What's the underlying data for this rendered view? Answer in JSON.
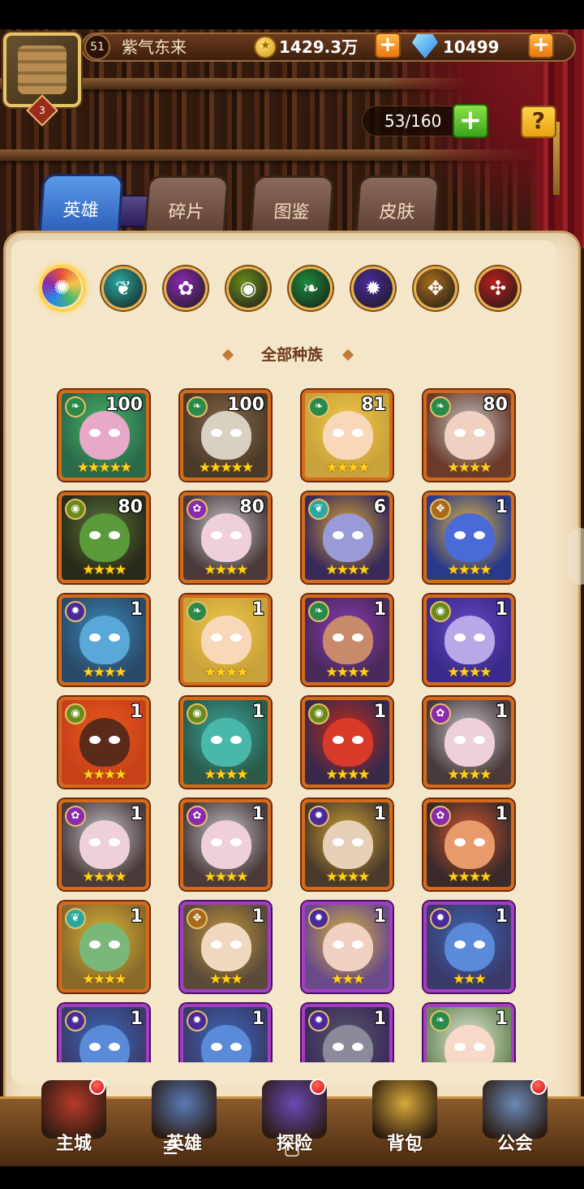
{
  "player": {
    "level": "51",
    "name": "紫气东来",
    "avatar_level": "3"
  },
  "resources": {
    "gold": "1429.3万",
    "gems": "10499"
  },
  "capacity": "53/160",
  "tabs": [
    {
      "label": "英雄",
      "active": true
    },
    {
      "label": "碎片",
      "active": false
    },
    {
      "label": "图鉴",
      "active": false
    },
    {
      "label": "皮肤",
      "active": false
    }
  ],
  "race_filters": [
    {
      "name": "all-races",
      "color": "#e8503a"
    },
    {
      "name": "fortress",
      "color": "#2aa8a0"
    },
    {
      "name": "abyss",
      "color": "#8a2ab0"
    },
    {
      "name": "forest",
      "color": "#6a8a1a"
    },
    {
      "name": "shadow",
      "color": "#1a8a3a"
    },
    {
      "name": "dark",
      "color": "#4a2a9a"
    },
    {
      "name": "light",
      "color": "#a86a1a"
    },
    {
      "name": "hell",
      "color": "#b8201a"
    }
  ],
  "race_title": "全部种族",
  "heroes": [
    {
      "level": "100",
      "stars": "★★★★★",
      "elem": "green",
      "tone": "#4ab86a",
      "skin": "#e8a8c8",
      "bg": "#2a6a4a",
      "frame": "orange"
    },
    {
      "level": "100",
      "stars": "★★★★★",
      "elem": "green",
      "tone": "#8a6a4a",
      "skin": "#d8d0c0",
      "bg": "#4a3a2a",
      "frame": "orange"
    },
    {
      "level": "81",
      "stars": "★★★★",
      "elem": "green",
      "tone": "#f2c84a",
      "skin": "#f8d8b8",
      "bg": "#c8a23a",
      "frame": "orange"
    },
    {
      "level": "80",
      "stars": "★★★★",
      "elem": "green",
      "tone": "#c8c8c8",
      "skin": "#f0d0c0",
      "bg": "#6a3a2a",
      "frame": "orange"
    },
    {
      "level": "80",
      "stars": "★★★★",
      "elem": "olive",
      "tone": "#5a7a3a",
      "skin": "#5a9a3a",
      "bg": "#2a2a1a",
      "frame": "orange"
    },
    {
      "level": "80",
      "stars": "★★★★",
      "elem": "purple",
      "tone": "#c8c8d0",
      "skin": "#f0d0d8",
      "bg": "#4a3a3a",
      "frame": "orange"
    },
    {
      "level": "6",
      "stars": "★★★★",
      "elem": "teal",
      "tone": "#d8a83a",
      "skin": "#9a9ad8",
      "bg": "#3a2a5a",
      "frame": "orange"
    },
    {
      "level": "1",
      "stars": "★★★★",
      "elem": "sun",
      "tone": "#e8b83a",
      "skin": "#4a6ad8",
      "bg": "#2a3a8a",
      "frame": "orange"
    },
    {
      "level": "1",
      "stars": "★★★★",
      "elem": "dark",
      "tone": "#3a8ab8",
      "skin": "#5aa8d8",
      "bg": "#2a4a6a",
      "frame": "orange"
    },
    {
      "level": "1",
      "stars": "★★★★",
      "elem": "green",
      "tone": "#f2c84a",
      "skin": "#f8d8b8",
      "bg": "#c8a23a",
      "frame": "orange"
    },
    {
      "level": "1",
      "stars": "★★★★",
      "elem": "green",
      "tone": "#8a3ab8",
      "skin": "#c88a6a",
      "bg": "#4a2a5a",
      "frame": "orange"
    },
    {
      "level": "1",
      "stars": "★★★★",
      "elem": "olive",
      "tone": "#6a4ac8",
      "skin": "#b8a8e8",
      "bg": "#3a2a8a",
      "frame": "orange"
    },
    {
      "level": "1",
      "stars": "★★★★",
      "elem": "olive",
      "tone": "#e85a1a",
      "skin": "#5a2a1a",
      "bg": "#c8401a",
      "frame": "orange"
    },
    {
      "level": "1",
      "stars": "★★★★",
      "elem": "olive",
      "tone": "#3aa8a0",
      "skin": "#4ab8a8",
      "bg": "#2a5a4a",
      "frame": "orange"
    },
    {
      "level": "1",
      "stars": "★★★★",
      "elem": "olive",
      "tone": "#c82a1a",
      "skin": "#d83a2a",
      "bg": "#3a2a4a",
      "frame": "orange"
    },
    {
      "level": "1",
      "stars": "★★★★",
      "elem": "purple",
      "tone": "#c8c8d0",
      "skin": "#f0d0d8",
      "bg": "#4a3a3a",
      "frame": "orange"
    },
    {
      "level": "1",
      "stars": "★★★★",
      "elem": "purple",
      "tone": "#c8c8d0",
      "skin": "#f0d0d8",
      "bg": "#4a3a3a",
      "frame": "orange"
    },
    {
      "level": "1",
      "stars": "★★★★",
      "elem": "purple",
      "tone": "#c8c8d0",
      "skin": "#f0d0d8",
      "bg": "#4a3a3a",
      "frame": "orange"
    },
    {
      "level": "1",
      "stars": "★★★★",
      "elem": "dark",
      "tone": "#d8a83a",
      "skin": "#e8d0b8",
      "bg": "#4a3a2a",
      "frame": "orange"
    },
    {
      "level": "1",
      "stars": "★★★★",
      "elem": "purple",
      "tone": "#d85a2a",
      "skin": "#e89a6a",
      "bg": "#3a2a2a",
      "frame": "orange"
    },
    {
      "level": "1",
      "stars": "★★★★",
      "elem": "teal",
      "tone": "#d8b83a",
      "skin": "#7ab87a",
      "bg": "#8a6a2a",
      "frame": "orange"
    },
    {
      "level": "1",
      "stars": "★★★",
      "elem": "sun",
      "tone": "#c89a3a",
      "skin": "#f0d8c0",
      "bg": "#5a4a3a",
      "frame": "purple"
    },
    {
      "level": "1",
      "stars": "★★★",
      "elem": "dark",
      "tone": "#d8b83a",
      "skin": "#f0d0c0",
      "bg": "#6a4a8a",
      "frame": "purple"
    },
    {
      "level": "1",
      "stars": "★★★",
      "elem": "dark",
      "tone": "#3a6ab8",
      "skin": "#5a8ad8",
      "bg": "#3a3a6a",
      "frame": "purple"
    },
    {
      "level": "1",
      "stars": "★★★",
      "elem": "dark",
      "tone": "#3a6ab8",
      "skin": "#5a8ad8",
      "bg": "#3a3a6a",
      "frame": "purple"
    },
    {
      "level": "1",
      "stars": "★★★",
      "elem": "dark",
      "tone": "#3a6ab8",
      "skin": "#5a8ad8",
      "bg": "#3a3a6a",
      "frame": "purple"
    },
    {
      "level": "1",
      "stars": "★★★",
      "elem": "dark",
      "tone": "#5a5a6a",
      "skin": "#8a8a9a",
      "bg": "#3a2a5a",
      "frame": "purple"
    },
    {
      "level": "1",
      "stars": "★★★",
      "elem": "green",
      "tone": "#e8e8d8",
      "skin": "#f8d8c8",
      "bg": "#6a8a5a",
      "frame": "purple"
    }
  ],
  "bottom_nav": [
    {
      "label": "主城",
      "badge": true,
      "icon": "castle-icon"
    },
    {
      "label": "英雄",
      "badge": false,
      "icon": "hero-icon"
    },
    {
      "label": "探险",
      "badge": true,
      "icon": "portal-icon"
    },
    {
      "label": "背包",
      "badge": false,
      "icon": "bag-icon"
    },
    {
      "label": "公会",
      "badge": true,
      "icon": "guild-icon"
    }
  ]
}
